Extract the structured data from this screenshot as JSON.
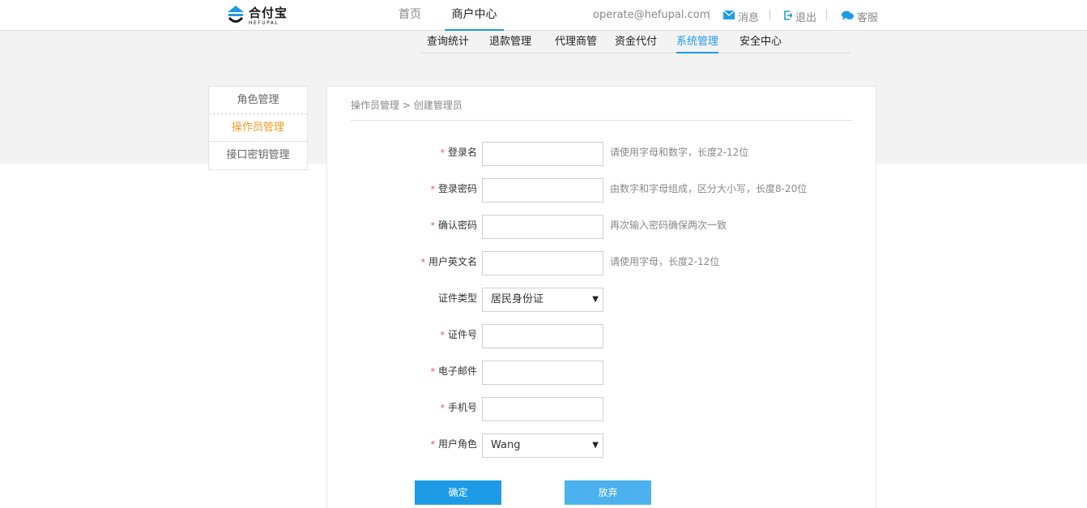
{
  "header": {
    "logo_cn": "合付宝",
    "logo_en": "HEFUPAL",
    "nav": [
      {
        "label": "首页"
      },
      {
        "label": "商户中心"
      }
    ],
    "user_email": "operate@hefupal.com",
    "links": {
      "messages": "消息",
      "logout": "退出",
      "service": "客服"
    }
  },
  "subnav": [
    {
      "label": "查询统计"
    },
    {
      "label": "退款管理"
    },
    {
      "label": "代理商管"
    },
    {
      "label": "资金代付"
    },
    {
      "label": "系统管理"
    },
    {
      "label": "安全中心"
    }
  ],
  "sidebar": {
    "items": [
      {
        "label": "角色管理"
      },
      {
        "label": "操作员管理"
      },
      {
        "label": "接口密钥管理"
      }
    ]
  },
  "breadcrumb": {
    "parent": "操作员管理",
    "separator": ">",
    "current": "创建管理员"
  },
  "form": {
    "required_mark": "*",
    "fields": [
      {
        "label": "登录名",
        "value": "",
        "hint": "请使用字母和数字，长度2-12位"
      },
      {
        "label": "登录密码",
        "value": "",
        "hint": "由数字和字母组成，区分大小写，长度8-20位"
      },
      {
        "label": "确认密码",
        "value": "",
        "hint": "再次输入密码确保两次一致"
      },
      {
        "label": "用户英文名",
        "value": "",
        "hint": "请使用字母，长度2-12位"
      },
      {
        "label": "证件类型",
        "value": "居民身份证",
        "hint": ""
      },
      {
        "label": "证件号",
        "value": "",
        "hint": ""
      },
      {
        "label": "电子邮件",
        "value": "",
        "hint": ""
      },
      {
        "label": "手机号",
        "value": "",
        "hint": ""
      },
      {
        "label": "用户角色",
        "value": "Wang",
        "hint": ""
      }
    ],
    "select_arrow": "▼",
    "confirm": "确定",
    "cancel": "放弃"
  },
  "colors": {
    "accent": "#1e9be6",
    "sidebar_active": "#f59a23",
    "required": "#e05050"
  }
}
